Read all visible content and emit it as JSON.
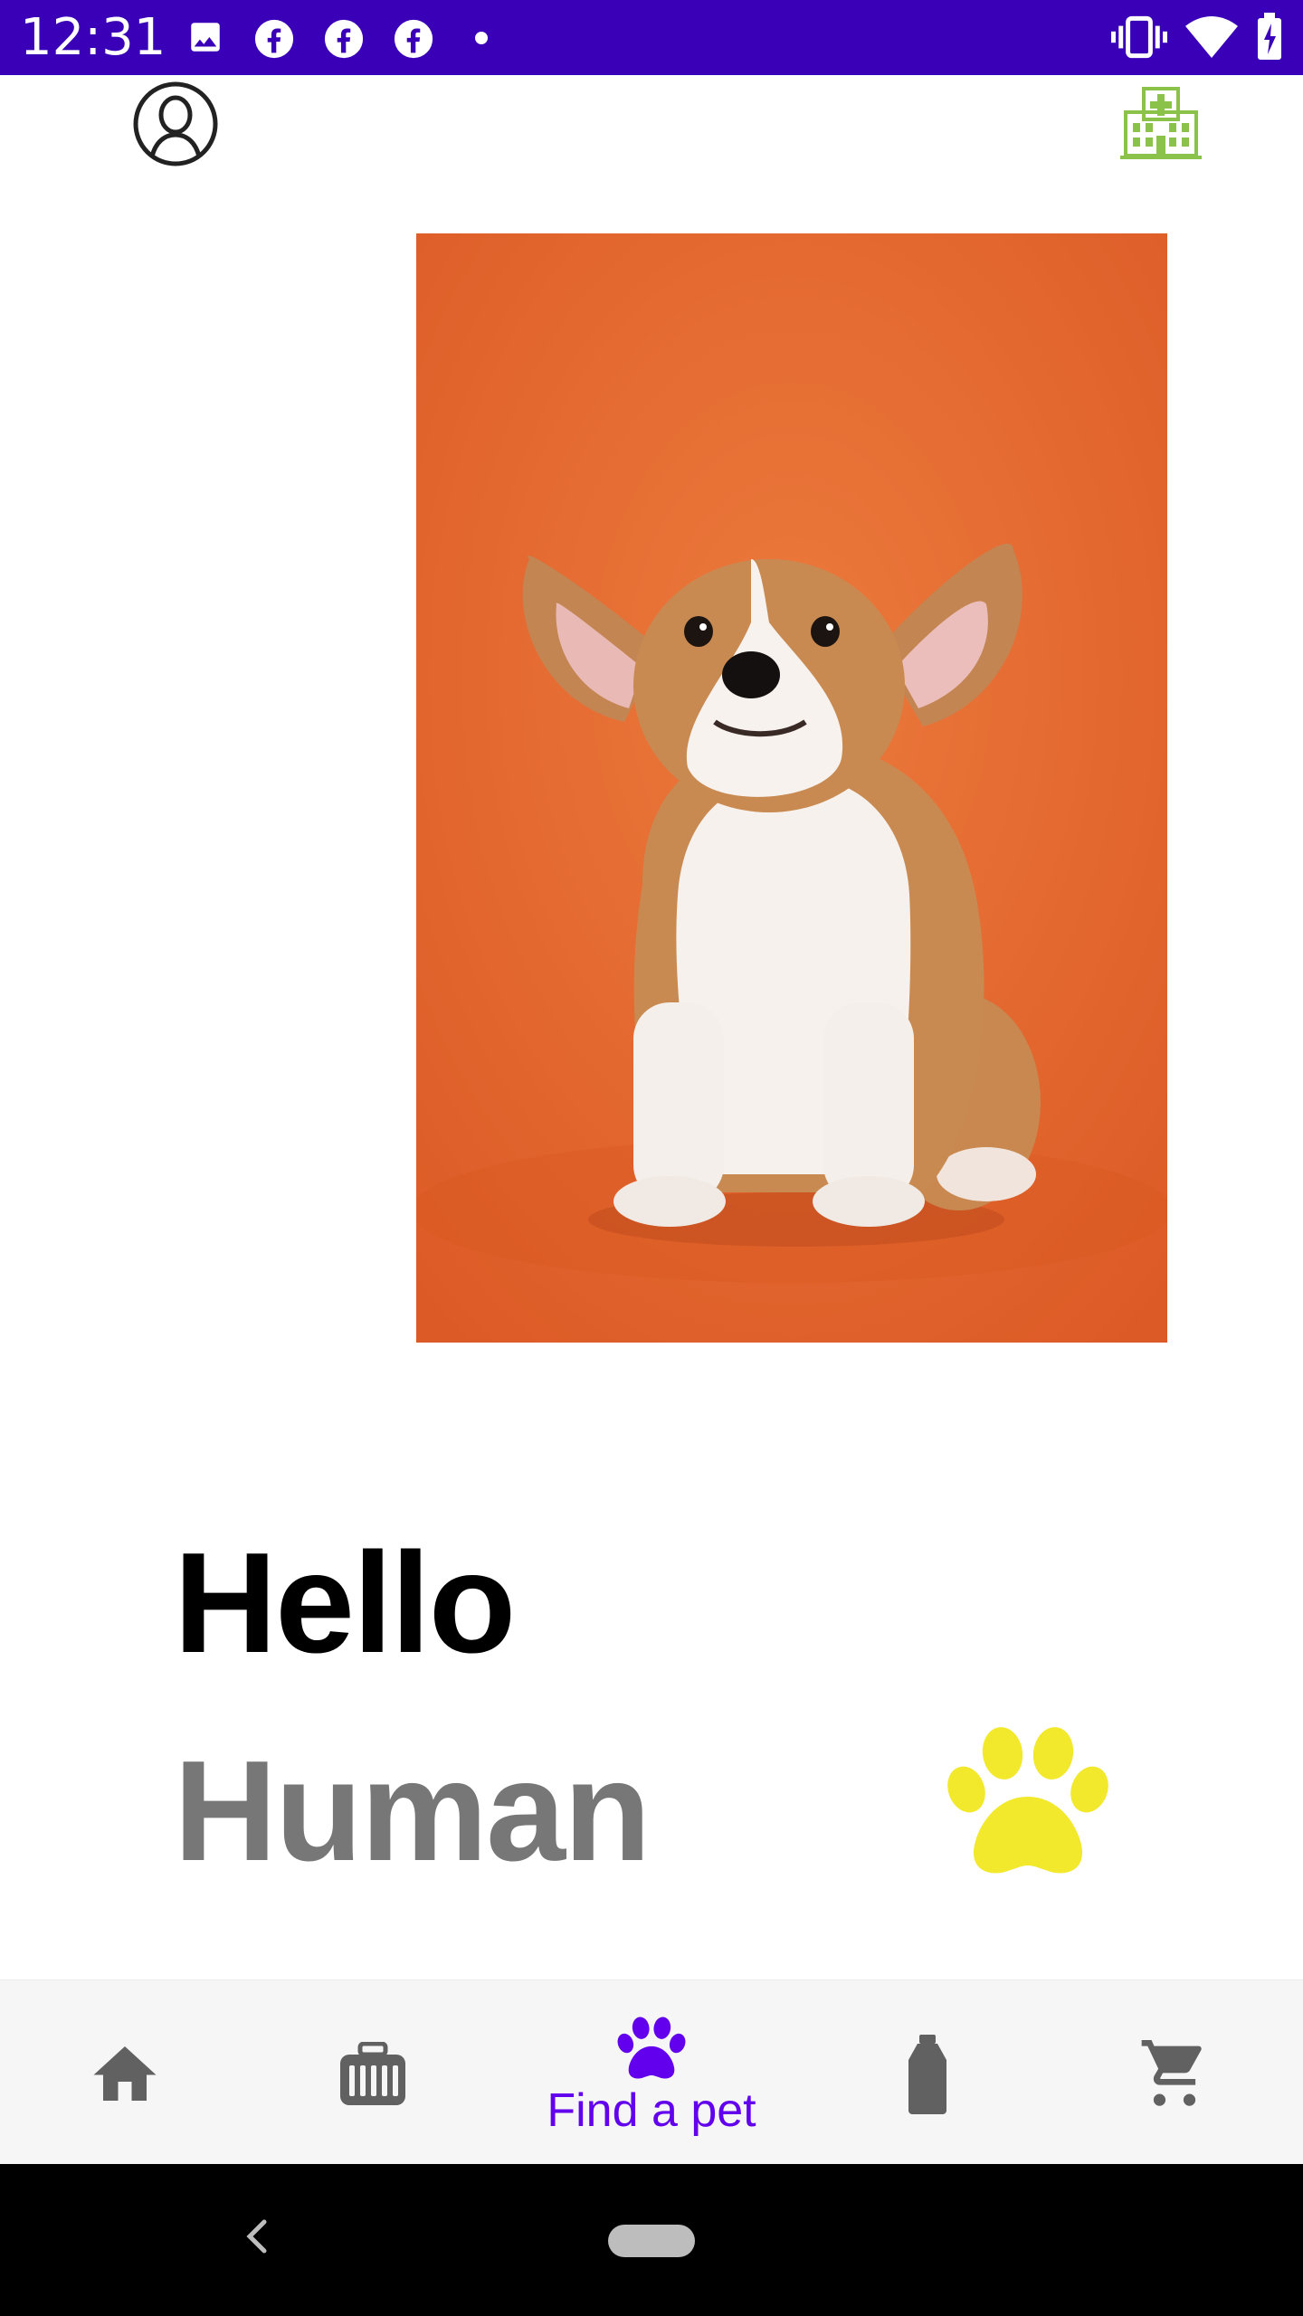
{
  "status_bar": {
    "time": "12:31",
    "background": "#3a00b8",
    "left_icons": [
      "image-notification-icon",
      "facebook-icon",
      "facebook-icon",
      "facebook-icon",
      "more-notifications-dot-icon"
    ],
    "right_icons": [
      "vibrate-icon",
      "wifi-icon",
      "battery-icon"
    ]
  },
  "top_bar": {
    "left_icon": "profile-icon",
    "right_icon": "hospital-icon",
    "accent_color": "#8bc34a"
  },
  "hero_image": {
    "subject": "corgi puppy on orange background",
    "background_color": "#e3642e"
  },
  "greeting": {
    "line1": "Hello",
    "line2": "Human",
    "line1_color": "#000000",
    "line2_color": "#777777",
    "paw_icon": "paw-icon",
    "paw_color": "#f2e82c"
  },
  "bottom_nav": {
    "active_color": "#6200ee",
    "inactive_color": "#616161",
    "items": [
      {
        "icon": "home-icon",
        "label": "",
        "active": false
      },
      {
        "icon": "pet-carrier-icon",
        "label": "",
        "active": false
      },
      {
        "icon": "paw-icon",
        "label": "Find a pet",
        "active": true
      },
      {
        "icon": "bottle-icon",
        "label": "",
        "active": false
      },
      {
        "icon": "cart-icon",
        "label": "",
        "active": false
      }
    ]
  },
  "system_nav": {
    "back_icon": "back-chevron-icon",
    "home_icon": "home-pill"
  }
}
